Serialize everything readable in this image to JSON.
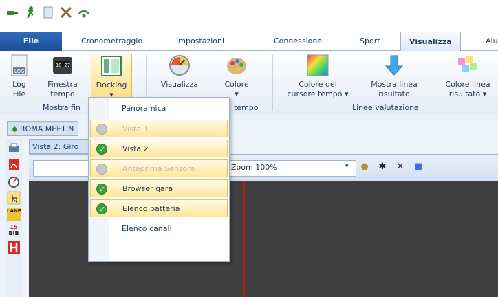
{
  "quick_access": {
    "icons": [
      "toolbar-green-plug-icon",
      "running-man-icon",
      "document-icon",
      "tools-icon",
      "wifi-icon"
    ]
  },
  "tabs": {
    "file": "File",
    "items": [
      "Cronometraggio",
      "Impostazioni",
      "Connessione",
      "Sport",
      "Visualizza",
      "Aiu"
    ]
  },
  "ribbon": {
    "log_line1": "Log",
    "log_line2": "File",
    "finestra_line1": "Finestra",
    "finestra_line2": "tempo",
    "docking": "Docking",
    "docking_arrow": "▾",
    "visualizza": "Visualizza",
    "colore": "Colore",
    "colore_arrow": "▾",
    "colore_cursore_line1": "Colore del",
    "colore_cursore_line2": "cursore tempo ▾",
    "mostra_linea_line1": "Mostra linea",
    "mostra_linea_line2": "risultato",
    "colore_linea_line1": "Colore linea",
    "colore_linea_line2": "risultato ▾",
    "group_mostra": "Mostra fin",
    "group_tempo": "tempo",
    "group_linee": "Linee valutazione"
  },
  "document": {
    "doc_tab": "ROMA MEETIN",
    "view_tab": "Vista 2: Giro",
    "zoom": "Zoom 100%",
    "zoom_arrow": "▾"
  },
  "menu": {
    "header": "Panoramica",
    "items": [
      {
        "label": "Vista 1",
        "state": "disabled"
      },
      {
        "label": "Vista 2",
        "state": "checked"
      },
      {
        "label": "Anteprima Sensore",
        "state": "disabled"
      },
      {
        "label": "Browser gara",
        "state": "checked"
      },
      {
        "label": "Elenco batteria",
        "state": "checked"
      }
    ],
    "footer": "Elenco canali"
  },
  "side_toolbar": {
    "badge_lane": "LANE",
    "badge_bib_num": "15",
    "badge_bib": "BIB"
  },
  "colors": {
    "accent": "#2f6dbb",
    "highlight": "#ffe08a",
    "check_green": "#3aa23a",
    "canvas": "#404040",
    "cursor_line": "#c01818"
  }
}
